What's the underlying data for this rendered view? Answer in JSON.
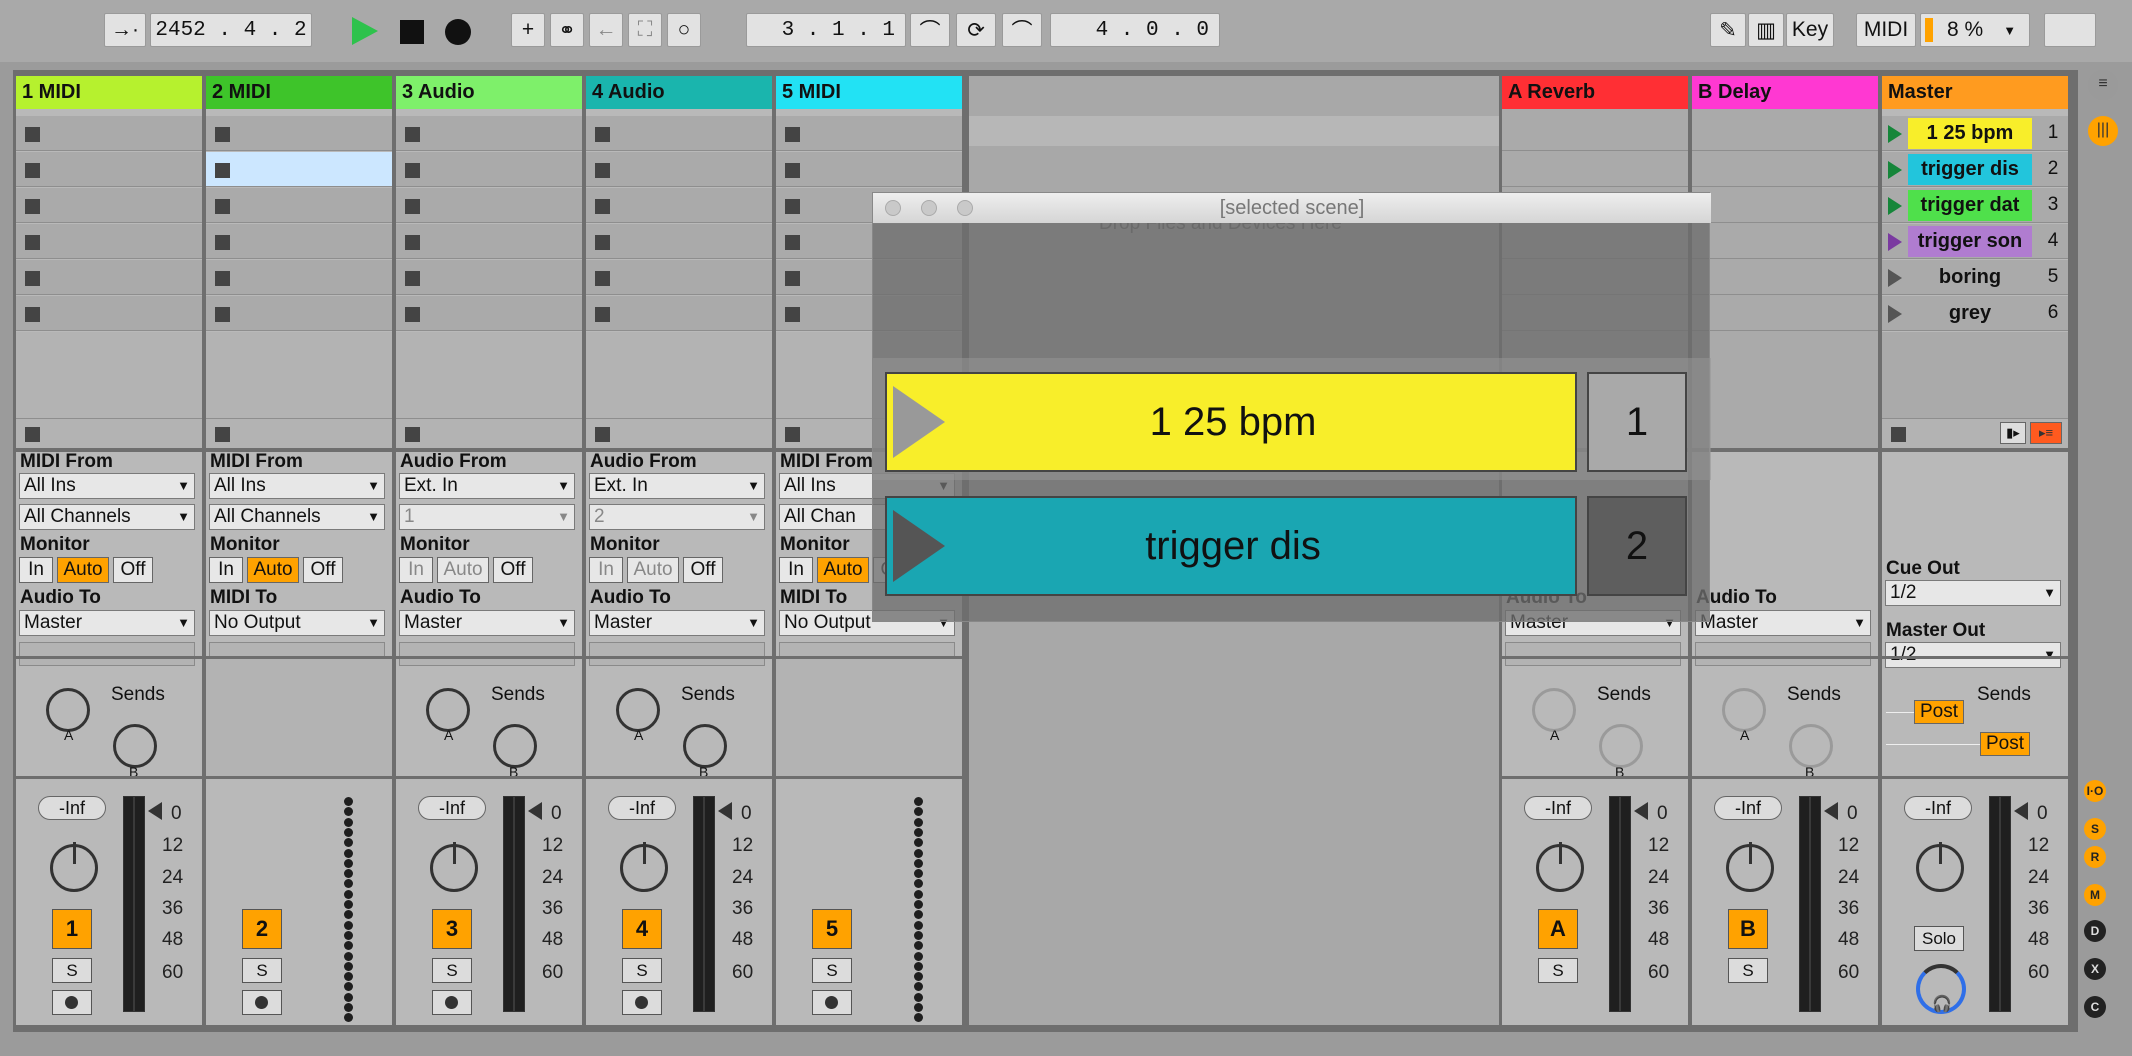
{
  "transport": {
    "arrangement_position": "2452 .  4 .  2",
    "loop_start": "3 .  1 .  1",
    "loop_length": "4 .  0 .  0",
    "key_label": "Key",
    "midi_label": "MIDI",
    "cpu": "8 %"
  },
  "tracks": [
    {
      "name": "1 MIDI",
      "color": "#b6f12e",
      "input_label": "MIDI From",
      "input": "All Ins",
      "channel": "All Channels",
      "monitor_label": "Monitor",
      "mon_in": "In",
      "mon_auto": "Auto",
      "mon_off": "Off",
      "output_label": "Audio To",
      "output": "Master",
      "sends_label": "Sends",
      "volume": "-Inf",
      "number": "1",
      "solo": "S"
    },
    {
      "name": "2 MIDI",
      "color": "#3ec42a",
      "input_label": "MIDI From",
      "input": "All Ins",
      "channel": "All Channels",
      "monitor_label": "Monitor",
      "mon_in": "In",
      "mon_auto": "Auto",
      "mon_off": "Off",
      "output_label": "MIDI To",
      "output": "No Output",
      "sends_label": "",
      "volume": "",
      "number": "2",
      "solo": "S"
    },
    {
      "name": "3 Audio",
      "color": "#7ef06a",
      "input_label": "Audio From",
      "input": "Ext. In",
      "channel": "1",
      "monitor_label": "Monitor",
      "mon_in": "In",
      "mon_auto": "Auto",
      "mon_off": "Off",
      "output_label": "Audio To",
      "output": "Master",
      "sends_label": "Sends",
      "volume": "-Inf",
      "number": "3",
      "solo": "S"
    },
    {
      "name": "4 Audio",
      "color": "#1ab5ad",
      "input_label": "Audio From",
      "input": "Ext. In",
      "channel": "2",
      "monitor_label": "Monitor",
      "mon_in": "In",
      "mon_auto": "Auto",
      "mon_off": "Off",
      "output_label": "Audio To",
      "output": "Master",
      "sends_label": "Sends",
      "volume": "-Inf",
      "number": "4",
      "solo": "S"
    },
    {
      "name": "5 MIDI",
      "color": "#22e2f4",
      "input_label": "MIDI From",
      "input": "All Ins",
      "channel": "All Chan",
      "monitor_label": "Monitor",
      "mon_in": "In",
      "mon_auto": "Auto",
      "mon_off": "Off",
      "output_label": "MIDI To",
      "output": "No Output",
      "sends_label": "",
      "volume": "",
      "number": "5",
      "solo": "S"
    }
  ],
  "returns": [
    {
      "name": "A Reverb",
      "color": "#ff2f34",
      "output_label": "Audio To",
      "output": "Master",
      "sends_label": "Sends",
      "volume": "-Inf",
      "number": "A",
      "solo": "S"
    },
    {
      "name": "B Delay",
      "color": "#ff38d2",
      "output_label": "Audio To",
      "output": "Master",
      "sends_label": "Sends",
      "volume": "-Inf",
      "number": "B",
      "solo": "S"
    }
  ],
  "master": {
    "name": "Master",
    "color": "#ff9b1f",
    "cue_out_label": "Cue Out",
    "cue_out": "1/2",
    "master_out_label": "Master Out",
    "master_out": "1/2",
    "sends_label": "Sends",
    "post1": "Post",
    "post2": "Post",
    "volume": "-Inf",
    "solo_label": "Solo"
  },
  "scenes": [
    {
      "name": "1 25 bpm",
      "number": "1",
      "color": "#f8ee2a"
    },
    {
      "name": "trigger dis",
      "number": "2",
      "color": "#22c5dc"
    },
    {
      "name": "trigger dat",
      "number": "3",
      "color": "#4fe04b"
    },
    {
      "name": "trigger son",
      "number": "4",
      "color": "#b07cd0"
    },
    {
      "name": "boring",
      "number": "5",
      "color": "#a3a3a3"
    },
    {
      "name": "grey",
      "number": "6",
      "color": "#a3a3a3"
    }
  ],
  "scale": [
    "0",
    "12",
    "24",
    "36",
    "48",
    "60"
  ],
  "popup": {
    "title": "[selected scene]",
    "behind_text": "Drop Files and Devices Here",
    "scene1_name": "1 25 bpm",
    "scene1_num": "1",
    "scene2_name": "trigger dis",
    "scene2_num": "2"
  },
  "right_buttons": [
    "I·O",
    "S",
    "R",
    "M",
    "D",
    "X",
    "C"
  ]
}
